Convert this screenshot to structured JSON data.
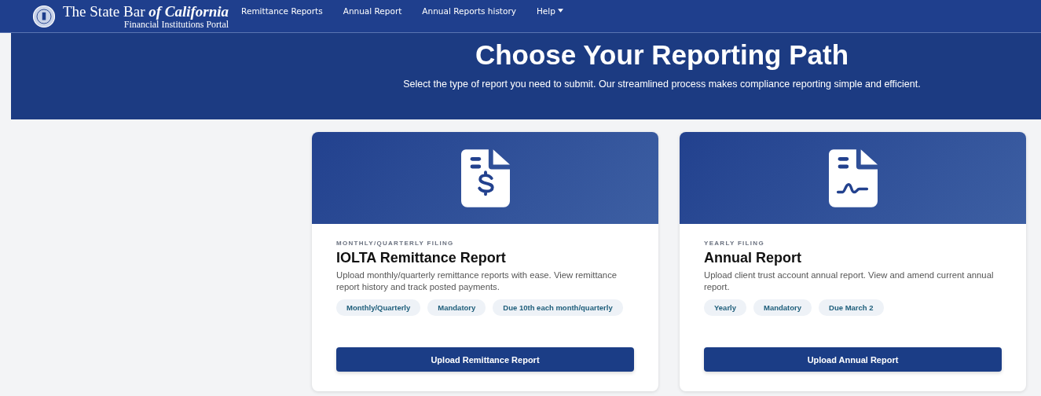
{
  "navbar": {
    "brand": {
      "title": "The State Bar *of California*",
      "subtitle": "Financial Institutions Portal"
    },
    "links": [
      {
        "label": "Remittance Reports",
        "dropdown": false
      },
      {
        "label": "Annual Report",
        "dropdown": false
      },
      {
        "label": "Annual Reports history",
        "dropdown": false
      },
      {
        "label": "Help",
        "dropdown": true
      }
    ]
  },
  "hero": {
    "title": "Choose Your Reporting Path",
    "subtitle": "Select the type of report you need to submit. Our streamlined process makes compliance reporting simple and efficient."
  },
  "cards": [
    {
      "kind": "dollar",
      "eyebrow": "MONTHLY/QUARTERLY FILING",
      "title": "IOLTA Remittance Report",
      "description": "Upload monthly/quarterly remittance reports with ease. View remittance report history and track posted payments.",
      "tags": [
        "Monthly/Quarterly",
        "Mandatory",
        "Due 10th each month/quarterly"
      ],
      "button": "Upload Remittance Report"
    },
    {
      "kind": "signature",
      "eyebrow": "YEARLY FILING",
      "title": "Annual Report",
      "description": "Upload client trust account annual report. View and amend current annual report.",
      "tags": [
        "Yearly",
        "Mandatory",
        "Due March 2"
      ],
      "button": "Upload Annual Report"
    }
  ]
}
